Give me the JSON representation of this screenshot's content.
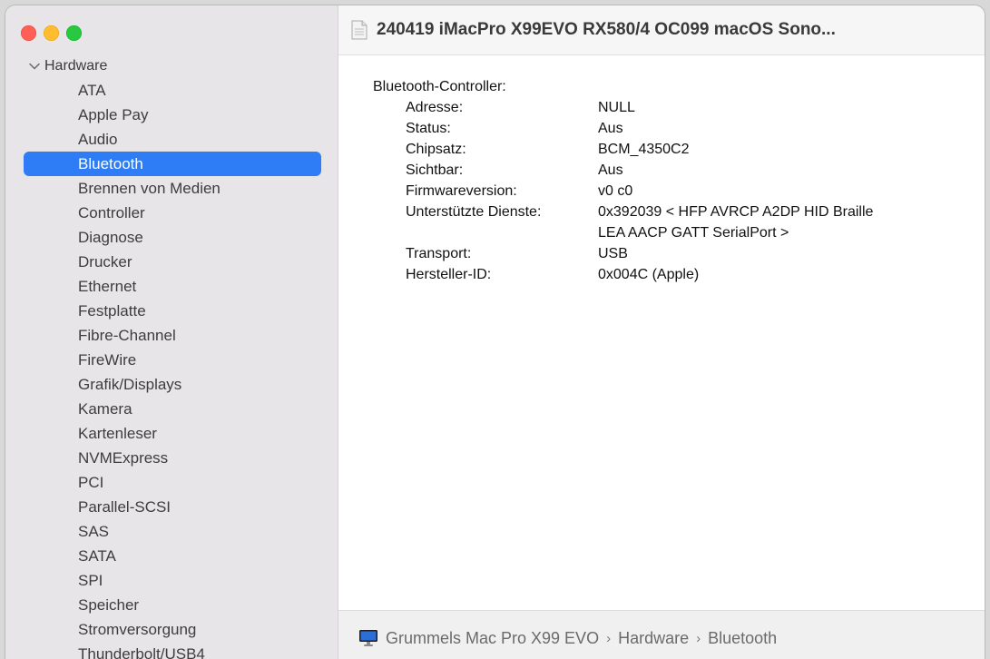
{
  "window": {
    "title": "240419 iMacPro X99EVO RX580/4 OC099 macOS Sono..."
  },
  "sidebar": {
    "section": "Hardware",
    "items": [
      {
        "label": "ATA"
      },
      {
        "label": "Apple Pay"
      },
      {
        "label": "Audio"
      },
      {
        "label": "Bluetooth",
        "selected": true
      },
      {
        "label": "Brennen von Medien"
      },
      {
        "label": "Controller"
      },
      {
        "label": "Diagnose"
      },
      {
        "label": "Drucker"
      },
      {
        "label": "Ethernet"
      },
      {
        "label": "Festplatte"
      },
      {
        "label": "Fibre-Channel"
      },
      {
        "label": "FireWire"
      },
      {
        "label": "Grafik/Displays"
      },
      {
        "label": "Kamera"
      },
      {
        "label": "Kartenleser"
      },
      {
        "label": "NVMExpress"
      },
      {
        "label": "PCI"
      },
      {
        "label": "Parallel-SCSI"
      },
      {
        "label": "SAS"
      },
      {
        "label": "SATA"
      },
      {
        "label": "SPI"
      },
      {
        "label": "Speicher"
      },
      {
        "label": "Stromversorgung"
      },
      {
        "label": "Thunderbolt/USB4"
      }
    ]
  },
  "content": {
    "heading": "Bluetooth-Controller:",
    "properties": [
      {
        "key": "Adresse:",
        "value": "NULL"
      },
      {
        "key": "Status:",
        "value": "Aus"
      },
      {
        "key": "Chipsatz:",
        "value": "BCM_4350C2"
      },
      {
        "key": "Sichtbar:",
        "value": "Aus"
      },
      {
        "key": "Firmwareversion:",
        "value": "v0 c0"
      },
      {
        "key": "Unterstützte Dienste:",
        "value": "0x392039 < HFP AVRCP A2DP HID Braille",
        "value2": "LEA AACP GATT SerialPort >"
      },
      {
        "key": "Transport:",
        "value": "USB"
      },
      {
        "key": "Hersteller-ID:",
        "value": "0x004C (Apple)"
      }
    ]
  },
  "footer": {
    "path": [
      "Grummels Mac Pro X99 EVO",
      "Hardware",
      "Bluetooth"
    ],
    "separator": "›"
  },
  "colors": {
    "accent": "#2e7cf6",
    "sidebar_bg": "#e8e5e8",
    "close": "#fe5f57",
    "minimize": "#febc2e",
    "zoom": "#28c840"
  },
  "icons": {
    "section_toggle": "chevron-down-icon",
    "title": "document-icon",
    "footer": "computer-icon"
  }
}
